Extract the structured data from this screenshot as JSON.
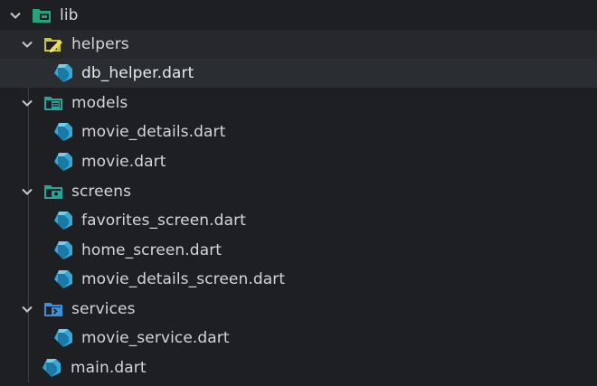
{
  "colors": {
    "background": "#1e1f22",
    "dart_icon": "#39a7d4",
    "folder_lib": "#27a37a",
    "folder_helpers": "#c8c43e",
    "folder_models": "#26a69a",
    "folder_screens": "#26a69a",
    "folder_services": "#3f8fd8"
  },
  "tree": {
    "root": {
      "label": "lib",
      "icon": "folder-lib-icon",
      "expanded": true
    },
    "helpers": {
      "label": "helpers",
      "icon": "folder-helpers-icon",
      "expanded": true
    },
    "db_helper": {
      "label": "db_helper.dart",
      "icon": "dart-file-icon"
    },
    "models": {
      "label": "models",
      "icon": "folder-models-icon",
      "expanded": true
    },
    "movie_details": {
      "label": "movie_details.dart",
      "icon": "dart-file-icon"
    },
    "movie": {
      "label": "movie.dart",
      "icon": "dart-file-icon"
    },
    "screens": {
      "label": "screens",
      "icon": "folder-screens-icon",
      "expanded": true
    },
    "favorites_screen": {
      "label": "favorites_screen.dart",
      "icon": "dart-file-icon"
    },
    "home_screen": {
      "label": "home_screen.dart",
      "icon": "dart-file-icon"
    },
    "movie_details_screen": {
      "label": "movie_details_screen.dart",
      "icon": "dart-file-icon"
    },
    "services": {
      "label": "services",
      "icon": "folder-services-icon",
      "expanded": true
    },
    "movie_service": {
      "label": "movie_service.dart",
      "icon": "dart-file-icon"
    },
    "main": {
      "label": "main.dart",
      "icon": "dart-file-icon"
    }
  }
}
